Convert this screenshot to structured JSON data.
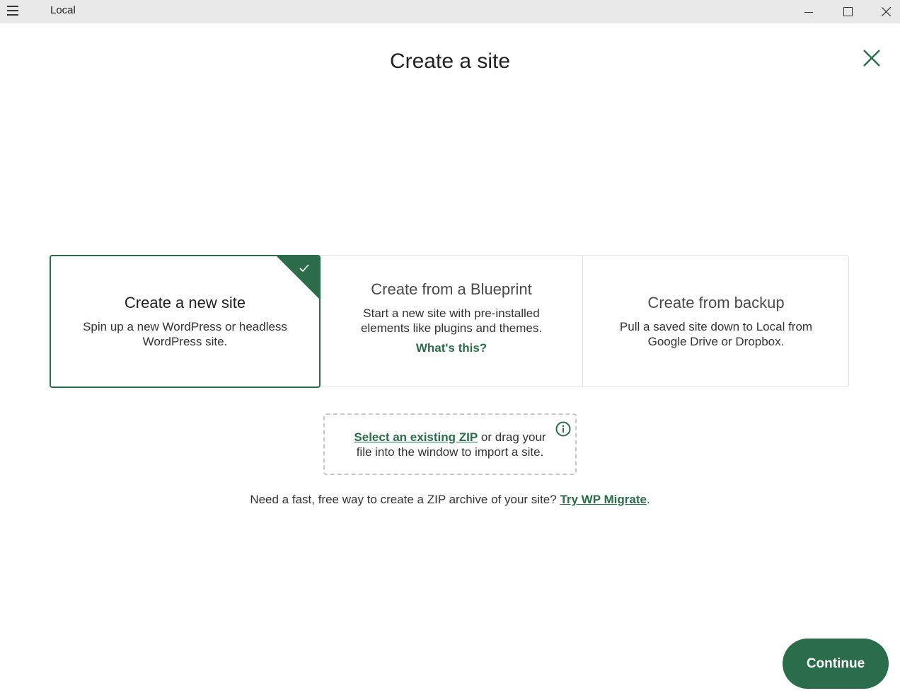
{
  "window": {
    "app_name": "Local",
    "menu_icon": "hamburger-menu-icon",
    "controls": [
      "minimize-icon",
      "maximize-icon",
      "close-icon"
    ]
  },
  "page": {
    "title": "Create a site",
    "close_icon": "close-x-icon"
  },
  "options": [
    {
      "title": "Create a new site",
      "description": "Spin up a new WordPress or headless WordPress site.",
      "selected": true
    },
    {
      "title": "Create from a Blueprint",
      "description": "Start a new site with pre-installed elements like plugins and themes.",
      "link": "What's this?",
      "selected": false
    },
    {
      "title": "Create from backup",
      "description": "Pull a saved site down to Local from Google Drive or Dropbox.",
      "selected": false
    }
  ],
  "dropzone": {
    "link_text": "Select an existing ZIP",
    "text": " or drag your file into the window to import a site.",
    "info_icon": "info-icon"
  },
  "migrate": {
    "text": "Need a fast, free way to create a ZIP archive of your site? ",
    "link_text": "Try WP Migrate",
    "suffix": "."
  },
  "footer": {
    "continue_label": "Continue"
  },
  "colors": {
    "accent": "#2b6c4a",
    "titlebar": "#e8e8e8"
  }
}
